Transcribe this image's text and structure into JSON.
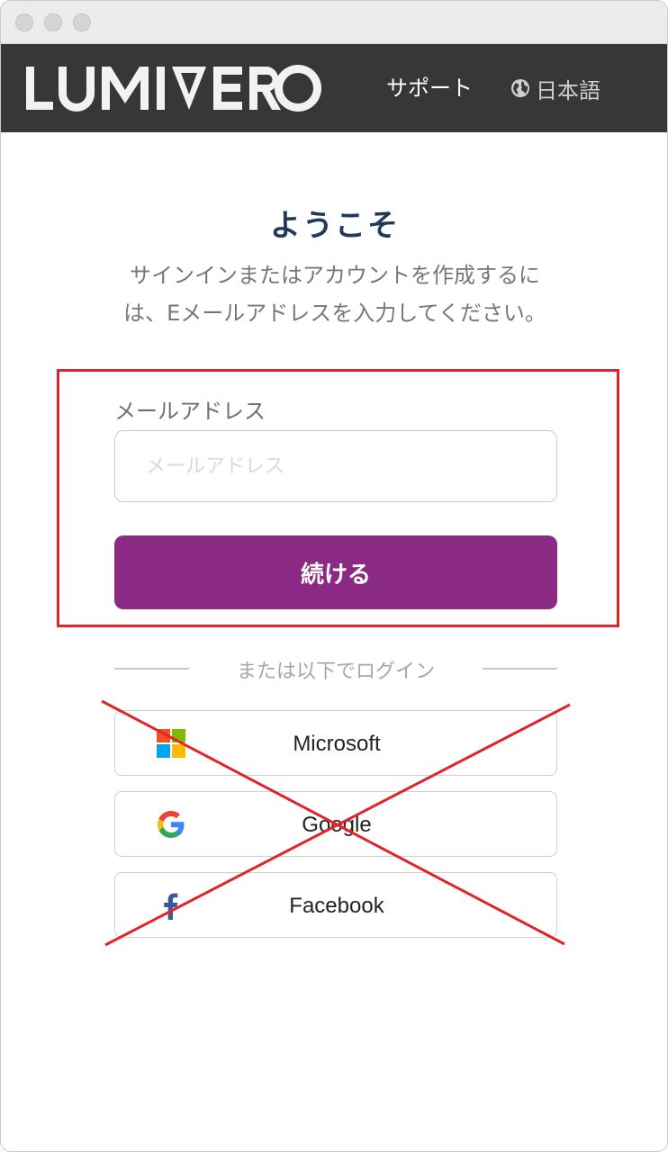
{
  "header": {
    "logo_text": "LUMIVERO",
    "support_label": "サポート",
    "language_label": "日本語",
    "background_color": "#373737"
  },
  "main": {
    "title": "ようこそ",
    "subtitle": "サインインまたはアカウントを作成するには、Eメールアドレスを入力してください。",
    "email_label": "メールアドレス",
    "email_placeholder": "メールアドレス",
    "email_value": "",
    "continue_label": "続ける",
    "continue_color": "#8b2a84",
    "divider_text": "または以下でログイン"
  },
  "social": [
    {
      "label": "Microsoft",
      "icon": "microsoft-icon"
    },
    {
      "label": "Google",
      "icon": "google-icon"
    },
    {
      "label": "Facebook",
      "icon": "facebook-icon"
    }
  ],
  "annotations": {
    "highlight_color": "#e0242c",
    "cross_color": "#e0242c"
  }
}
